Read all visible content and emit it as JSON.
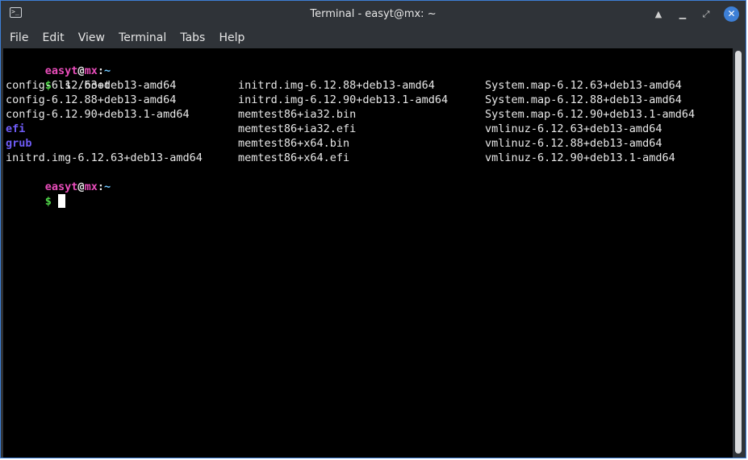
{
  "window": {
    "title": "Terminal - easyt@mx: ~",
    "app_icon_glyph": ">_",
    "buttons": {
      "minimize": "▲",
      "restore": "⤢",
      "close": "✕"
    }
  },
  "menubar": {
    "items": [
      "File",
      "Edit",
      "View",
      "Terminal",
      "Tabs",
      "Help"
    ]
  },
  "terminal": {
    "prompt": {
      "user": "easyt",
      "at": "@",
      "host": "mx",
      "colon": ":",
      "path": "~",
      "dollar": "$"
    },
    "command": " ls /boot",
    "listing": [
      [
        "config-6.12.63+deb13-amd64",
        "initrd.img-6.12.88+deb13-amd64",
        "System.map-6.12.63+deb13-amd64"
      ],
      [
        "config-6.12.88+deb13-amd64",
        "initrd.img-6.12.90+deb13.1-amd64",
        "System.map-6.12.88+deb13-amd64"
      ],
      [
        "config-6.12.90+deb13.1-amd64",
        "memtest86+ia32.bin",
        "System.map-6.12.90+deb13.1-amd64"
      ],
      [
        "efi",
        "memtest86+ia32.efi",
        "vmlinuz-6.12.63+deb13-amd64"
      ],
      [
        "grub",
        "memtest86+x64.bin",
        "vmlinuz-6.12.88+deb13-amd64"
      ],
      [
        "initrd.img-6.12.63+deb13-amd64",
        "memtest86+x64.efi",
        "vmlinuz-6.12.90+deb13.1-amd64"
      ]
    ],
    "directories": [
      "efi",
      "grub"
    ]
  },
  "colors": {
    "prompt_user": "#e94dbb",
    "prompt_dollar": "#52d84a",
    "directory": "#6f5cf7",
    "accent": "#3d7fd6"
  }
}
